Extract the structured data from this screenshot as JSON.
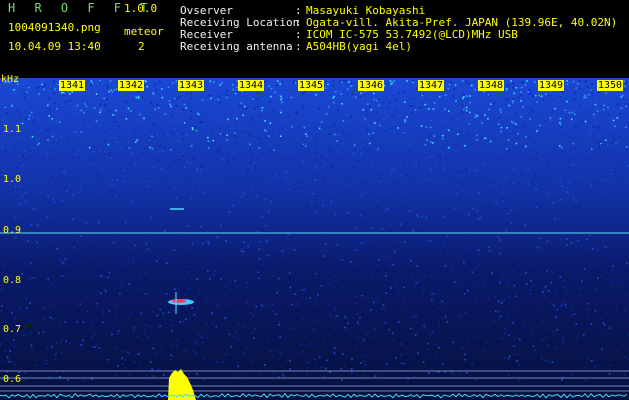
{
  "header": {
    "app_title": "H R O F F T",
    "app_version": "1.0.0",
    "file_name": "1004091340.png",
    "meteor_label": "meteor",
    "date_time": "10.04.09 13:40",
    "meteor_count": "2"
  },
  "info": [
    {
      "key": "Ovserver",
      "value": "Masayuki Kobayashi"
    },
    {
      "key": "Receiving Location",
      "value": "Ogata-vill. Akita-Pref. JAPAN (139.96E, 40.02N)"
    },
    {
      "key": "Receiver",
      "value": "ICOM IC-575 53.7492(@LCD)MHz USB"
    },
    {
      "key": "Receiving antenna",
      "value": "A504HB(yagi 4el)"
    }
  ],
  "separator": ":",
  "axis": {
    "unit": "kHz",
    "y_labels": [
      "1.1",
      "1.0",
      "0.9",
      "0.8",
      "0.7",
      "0.6"
    ],
    "time_labels": [
      "1341",
      "1342",
      "1343",
      "1344",
      "1345",
      "1346",
      "1347",
      "1348",
      "1349",
      "1350"
    ]
  },
  "colors": {
    "background": "#000000",
    "label_yellow": "#ffff00",
    "title_green": "#7ad67a",
    "signal_cyan": "#00d7ff",
    "noise_blue": "#1038c0"
  }
}
